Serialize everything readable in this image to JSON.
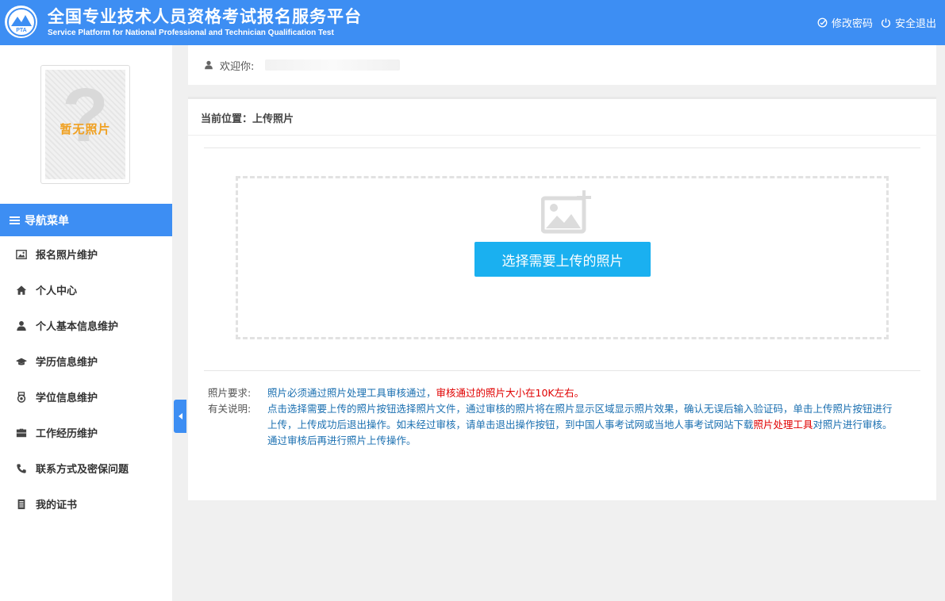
{
  "header": {
    "logo_text": "PTA",
    "title": "全国专业技术人员资格考试报名服务平台",
    "subtitle": "Service Platform for National Professional and Technician Qualification Test",
    "change_password": "修改密码",
    "logout": "安全退出"
  },
  "sidebar": {
    "photo_placeholder": "暂无照片",
    "photo_glyph": "?",
    "nav_title": "导航菜单",
    "items": [
      {
        "label": "报名照片维护",
        "icon": "image-icon"
      },
      {
        "label": "个人中心",
        "icon": "home-icon"
      },
      {
        "label": "个人基本信息维护",
        "icon": "user-icon"
      },
      {
        "label": "学历信息维护",
        "icon": "graduation-cap-icon"
      },
      {
        "label": "学位信息维护",
        "icon": "medal-icon"
      },
      {
        "label": "工作经历维护",
        "icon": "briefcase-icon"
      },
      {
        "label": "联系方式及密保问题",
        "icon": "phone-icon"
      },
      {
        "label": "我的证书",
        "icon": "book-icon"
      }
    ]
  },
  "welcome": {
    "label": "欢迎你:"
  },
  "main": {
    "breadcrumb": "当前位置：上传照片",
    "upload_button": "选择需要上传的照片",
    "requirements_label": "照片要求:",
    "requirements_text_blue": "照片必须通过照片处理工具审核通过，",
    "requirements_text_red": "审核通过的照片大小在10K左右。",
    "notes_label": "有关说明:",
    "notes_text_1": "点击选择需要上传的照片按钮选择照片文件，通过审核的照片将在照片显示区域显示照片效果，确认无误后输入验证码，单击上传照片按钮进行上传，上传成功后退出操作。如未经过审核，请单击退出操作按钮，到中国人事考试网或当地人事考试网站下载",
    "notes_link": "照片处理工具",
    "notes_text_2": "对照片进行审核。通过审核后再进行照片上传操作。"
  },
  "colors": {
    "primary": "#3d8ef3",
    "button": "#1ab0f0",
    "link_red": "#e00000",
    "text_blue": "#1a6fb0",
    "photo_text": "#f0a020"
  }
}
